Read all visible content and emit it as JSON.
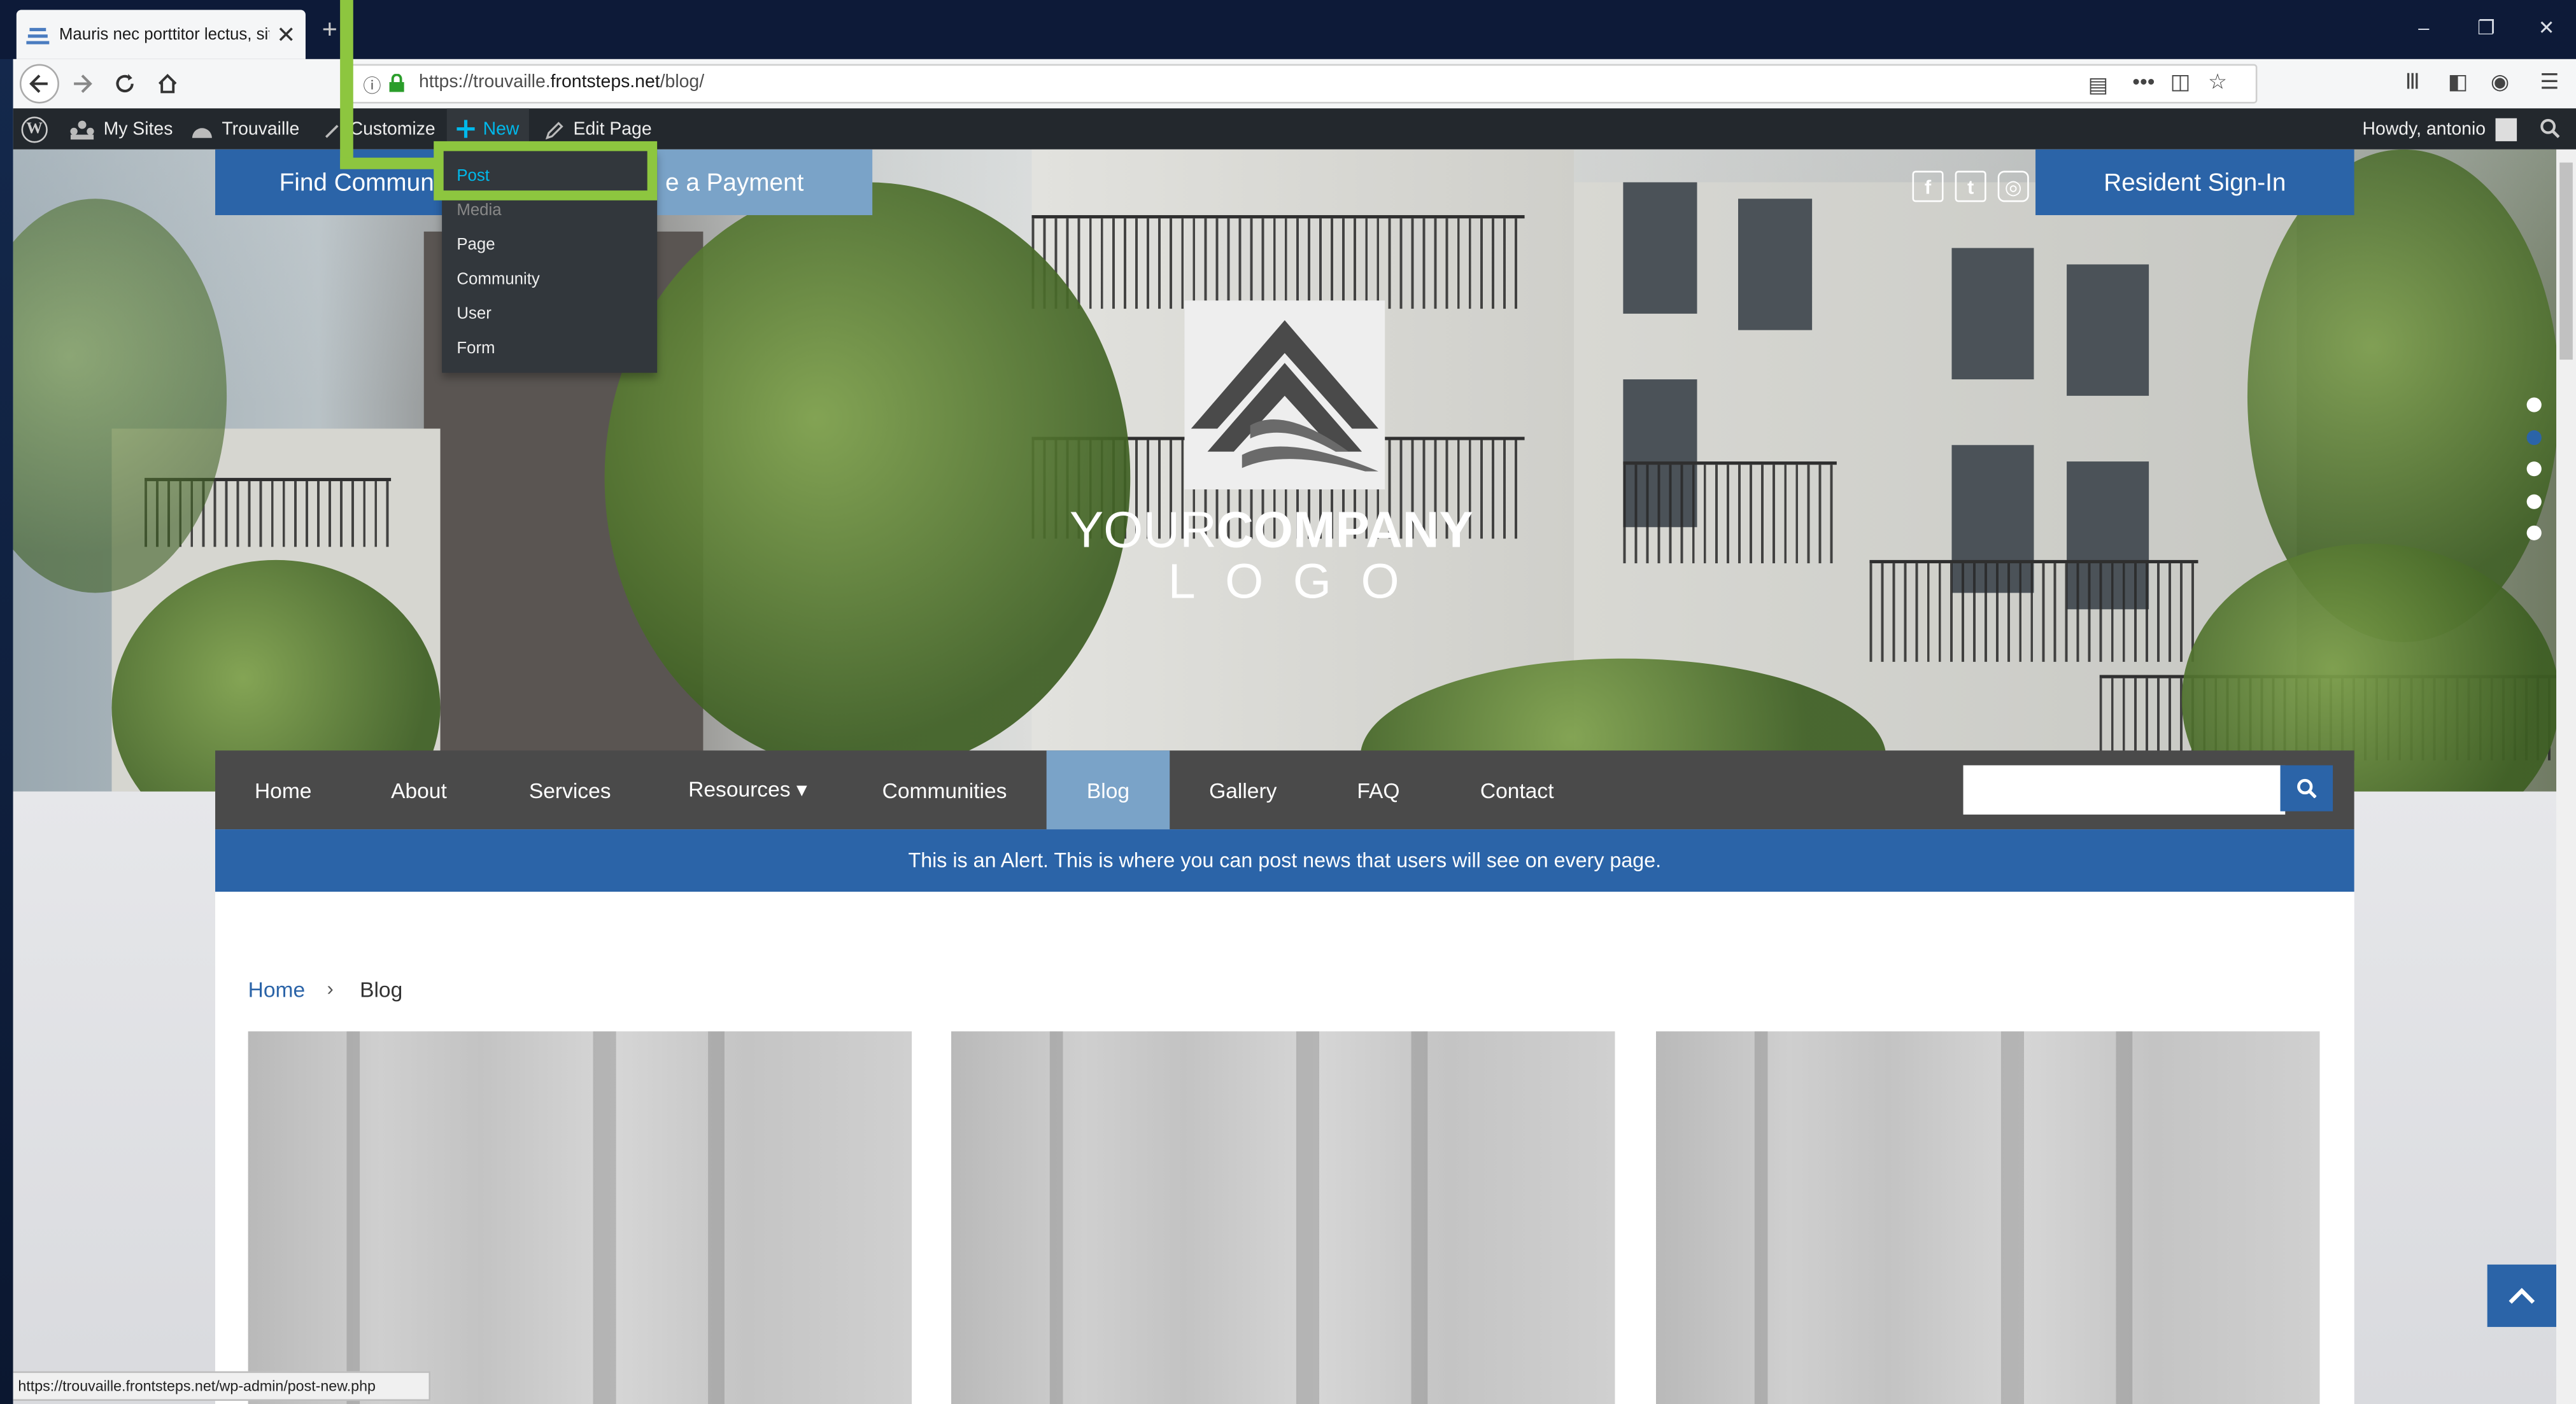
{
  "browser": {
    "tab_title": "Mauris nec porttitor lectus, sit a",
    "url_prefix": "https://trouvaille.",
    "url_host": "frontsteps.net",
    "url_path": "/blog/",
    "status_url": "https://trouvaille.frontsteps.net/wp-admin/post-new.php",
    "newtab": "+",
    "window_controls": [
      "–",
      "❐",
      "✕"
    ]
  },
  "wp_admin_bar": {
    "my_sites": "My Sites",
    "site_name": "Trouvaille",
    "customize": "Customize",
    "new": "New",
    "edit_page": "Edit Page",
    "howdy": "Howdy, antonio"
  },
  "new_menu": {
    "items": [
      "Post",
      "Media",
      "Page",
      "Community",
      "User",
      "Form"
    ]
  },
  "header_buttons": {
    "find": "Find Communi",
    "payment": "e a Payment",
    "resident": "Resident Sign-In"
  },
  "social": [
    "f",
    "t",
    "◎"
  ],
  "logo": {
    "line1_light": "YOUR",
    "line1_bold": "COMPANY",
    "line2": "LOGO"
  },
  "main_nav": {
    "items": [
      "Home",
      "About",
      "Services",
      "Resources ▾",
      "Communities",
      "Blog",
      "Gallery",
      "FAQ",
      "Contact"
    ],
    "active": "Blog"
  },
  "alert": "This is an Alert. This is where you can post news that users will see on every page.",
  "breadcrumb": {
    "home": "Home",
    "separator": "›",
    "current": "Blog"
  },
  "colors": {
    "primary_blue": "#2b64a8",
    "light_blue": "#7aa3c8",
    "nav_gray": "#4a4a4a",
    "highlight_green": "#8dc63f",
    "wp_bar": "#23282d"
  }
}
